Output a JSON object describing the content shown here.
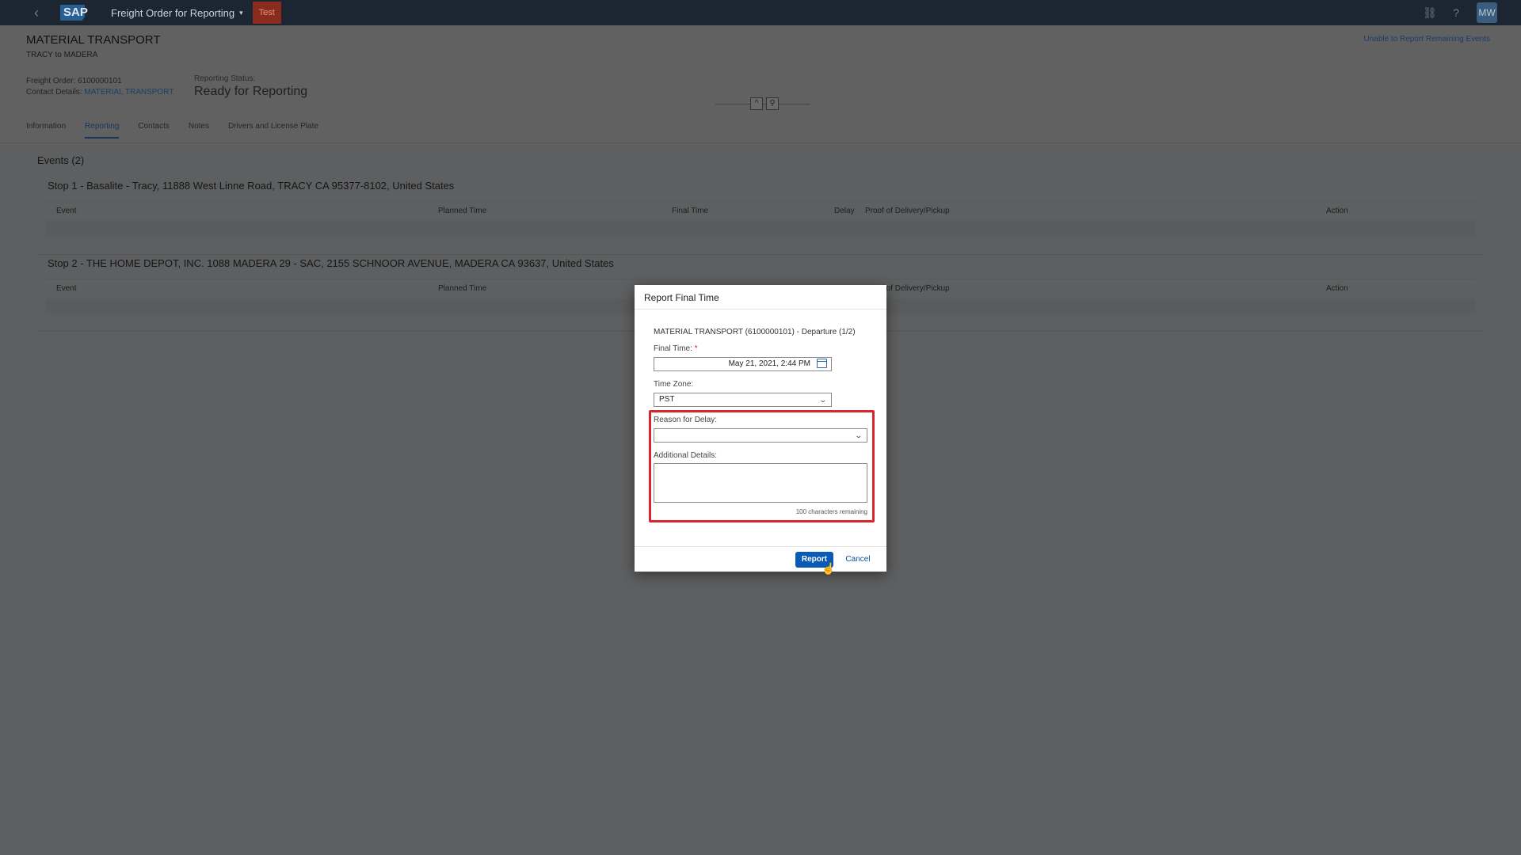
{
  "shell": {
    "app_title": "Freight Order for Reporting",
    "badge": "Test",
    "user_initials": "MW",
    "icons": [
      "back-icon",
      "link-icon",
      "help-icon"
    ]
  },
  "header": {
    "title": "MATERIAL TRANSPORT",
    "subtitle": "TRACY to MADERA",
    "freight_order": "Freight Order: 6100000101",
    "contact_label": "Contact Details:",
    "contact_value": "MATERIAL TRANSPORT",
    "status_label": "Reporting Status:",
    "status_value": "Ready for Reporting",
    "report_link": "Unable to Report Remaining Events",
    "tabs": [
      {
        "label": "Information"
      },
      {
        "label": "Reporting",
        "active": true
      },
      {
        "label": "Contacts"
      },
      {
        "label": "Notes"
      },
      {
        "label": "Drivers and License Plate"
      }
    ]
  },
  "content": {
    "events_title": "Events (2)",
    "stops": [
      {
        "title": "Stop 1 - Basalite - Tracy, 11888 West Linne Road, TRACY CA 95377-8102, United States"
      },
      {
        "title": "Stop 2 - THE HOME DEPOT, INC. 1088 MADERA 29 - SAC, 2155 SCHNOOR AVENUE, MADERA CA 93637, United States"
      }
    ],
    "columns": {
      "event": "Event",
      "planned": "Planned Time",
      "final": "Final Time",
      "delay": "Delay",
      "pod": "Proof of Delivery/Pickup",
      "action": "Action"
    }
  },
  "dialog": {
    "title": "Report Final Time",
    "subtitle": "MATERIAL TRANSPORT (6100000101) - Departure (1/2)",
    "final_time_label": "Final Time:",
    "final_time_value": "May 21, 2021, 2:44 PM",
    "time_zone_label": "Time Zone:",
    "time_zone_value": "PST",
    "delay_reason_label": "Reason for Delay:",
    "delay_reason_value": "",
    "details_label": "Additional Details:",
    "details_value": "",
    "counter": "100 characters remaining",
    "report_button": "Report",
    "cancel_button": "Cancel",
    "highlight_color": "#d6262f",
    "primary_color": "#0a5bb5"
  }
}
